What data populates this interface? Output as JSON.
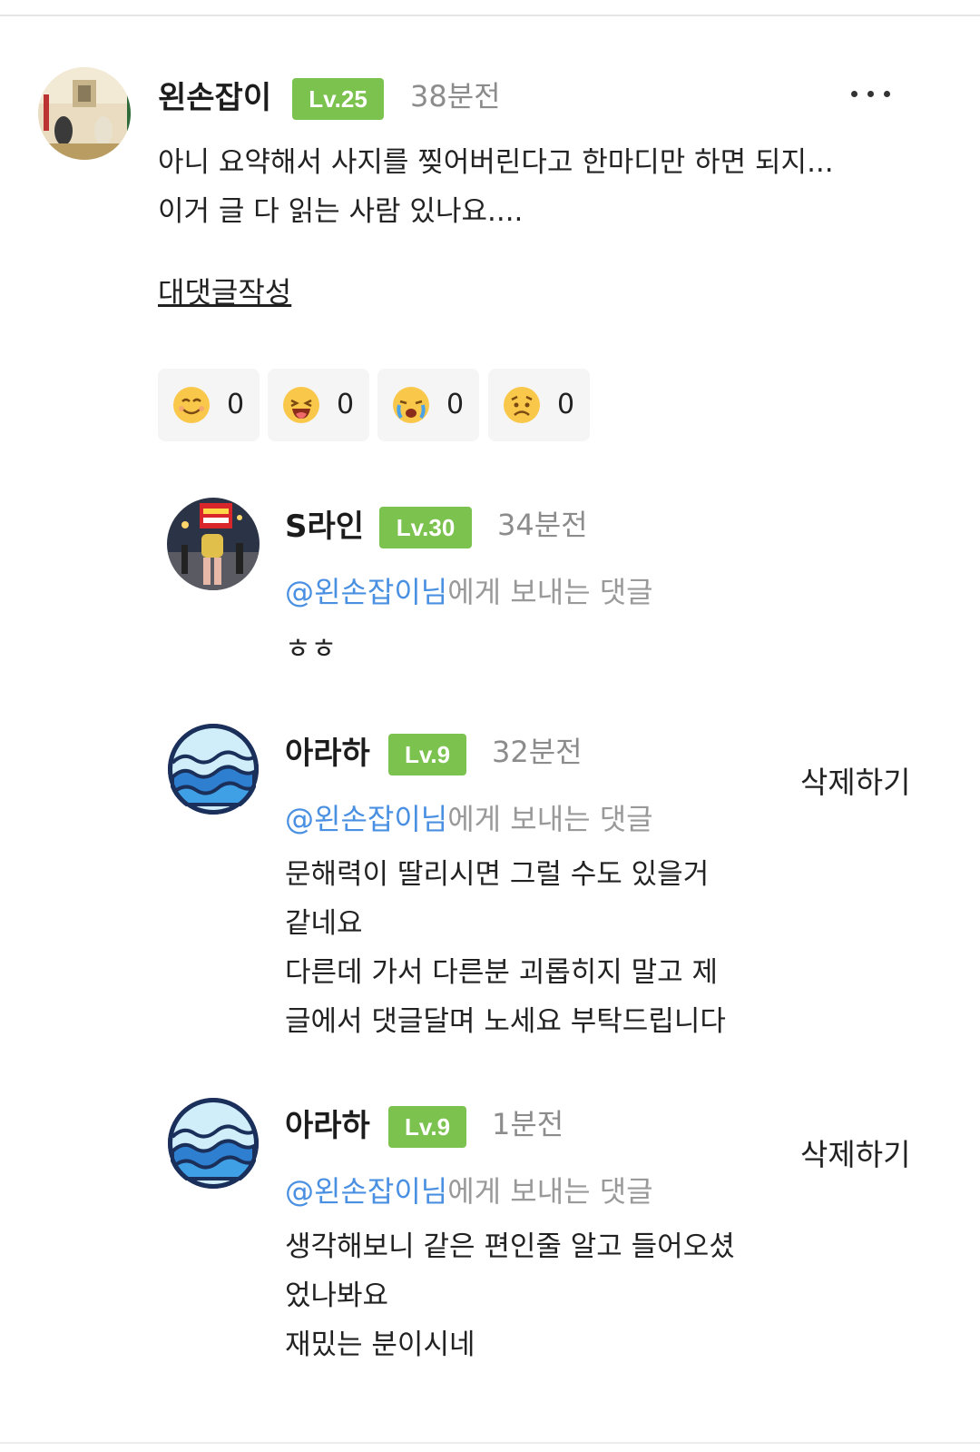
{
  "comment": {
    "author": "왼손잡이",
    "level": "Lv.25",
    "time": "38분전",
    "lines": [
      "아니 요약해서 사지를 찢어버린다고 한마디만 하면 되지...",
      "이거 글 다 읽는 사람 있나요...."
    ],
    "reply_label": "대댓글작성",
    "reactions": [
      {
        "icon": "smile-emoji-icon",
        "count": "0"
      },
      {
        "icon": "laugh-emoji-icon",
        "count": "0"
      },
      {
        "icon": "crying-emoji-icon",
        "count": "0"
      },
      {
        "icon": "worried-emoji-icon",
        "count": "0"
      }
    ]
  },
  "replies": [
    {
      "author": "S라인",
      "level": "Lv.30",
      "time": "34분전",
      "mention": "@왼손잡이님",
      "mention_suffix": "에게 보내는 댓글",
      "lines": [
        "ㅎㅎ"
      ]
    },
    {
      "author": "아라하",
      "level": "Lv.9",
      "time": "32분전",
      "delete_label": "삭제하기",
      "mention": "@왼손잡이님",
      "mention_suffix": "에게 보내는 댓글",
      "lines": [
        "문해력이 딸리시면 그럴 수도 있을거",
        "같네요",
        "다른데 가서 다른분 괴롭히지 말고 제",
        "글에서 댓글달며 노세요 부탁드립니다"
      ]
    },
    {
      "author": "아라하",
      "level": "Lv.9",
      "time": "1분전",
      "delete_label": "삭제하기",
      "mention": "@왼손잡이님",
      "mention_suffix": "에게 보내는 댓글",
      "lines": [
        "생각해보니 같은 편인줄 알고 들어오셨",
        "었나봐요",
        "재밌는 분이시네"
      ]
    }
  ],
  "colors": {
    "level_badge": "#7cc24f",
    "mention": "#4a90e2",
    "muted": "#999999"
  }
}
